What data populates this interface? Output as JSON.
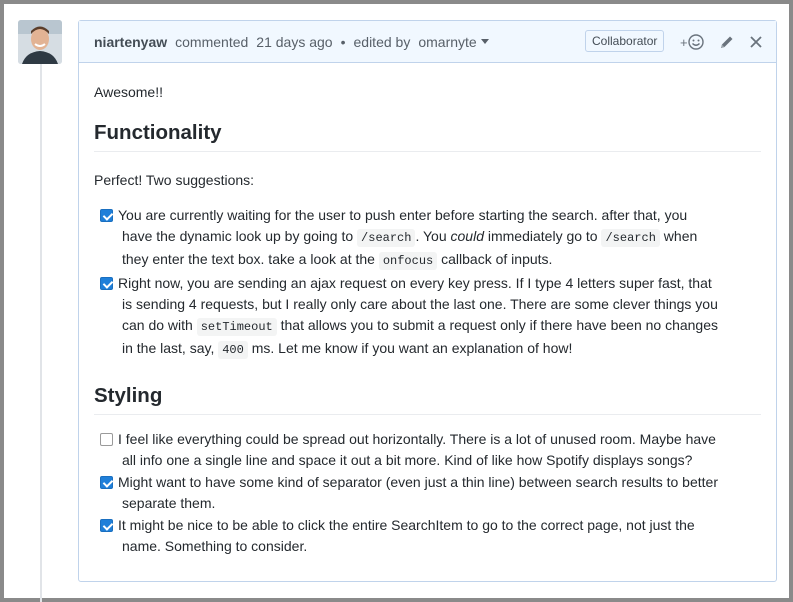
{
  "comment": {
    "author": "niartenyaw",
    "action": "commented",
    "time": "21 days ago",
    "bullet": "•",
    "edited_by_label": "edited by",
    "editor": "omarnyte",
    "role_badge": "Collaborator",
    "add_reaction_glyph": "+",
    "close_glyph": "✕"
  },
  "body": {
    "greeting": "Awesome!!",
    "functionality": {
      "heading": "Functionality",
      "intro": "Perfect! Two suggestions:",
      "tasks": [
        {
          "checked": true,
          "t1": "You are currently waiting for the user to push enter before starting the search. after that, you",
          "t2": "have the dynamic look up by going to ",
          "c1": "/search",
          "t3": ". You ",
          "em": "could",
          "t4": " immediately go to ",
          "c2": "/search",
          "t5": " when",
          "t6": "they enter the text box. take a look at the ",
          "c3": "onfocus",
          "t7": " callback of inputs."
        },
        {
          "checked": true,
          "t1": "Right now, you are sending an ajax request on every key press. If I type 4 letters super fast, that",
          "t2": "is sending 4 requests, but I really only care about the last one. There are some clever things you",
          "t3": "can do with ",
          "c1": "setTimeout",
          "t4": " that allows you to submit a request only if there have been no changes",
          "t5": "in the last, say, ",
          "c2": "400",
          "t6": " ms. Let me know if you want an explanation of how!"
        }
      ]
    },
    "styling": {
      "heading": "Styling",
      "tasks": [
        {
          "checked": false,
          "l1": "I feel like everything could be spread out horizontally. There is a lot of unused room. Maybe have",
          "l2": "all info one a single line and space it out a bit more. Kind of like how Spotify displays songs?"
        },
        {
          "checked": true,
          "l1": "Might want to have some kind of separator (even just a thin line) between search results to better",
          "l2": "separate them."
        },
        {
          "checked": true,
          "l1": "It might be nice to be able to click the entire SearchItem to go to the correct page, not just the",
          "l2": "name. Something to consider."
        }
      ]
    }
  },
  "icons": {
    "avatar": "avatar",
    "add_reaction": "smiley-icon",
    "edit": "pencil-icon",
    "close": "close-icon",
    "dropdown": "chevron-down-icon"
  },
  "colors": {
    "header_bg": "#f1f8ff",
    "border": "#c0d3eb",
    "checkbox": "#1f7fd9",
    "text": "#24292e"
  }
}
